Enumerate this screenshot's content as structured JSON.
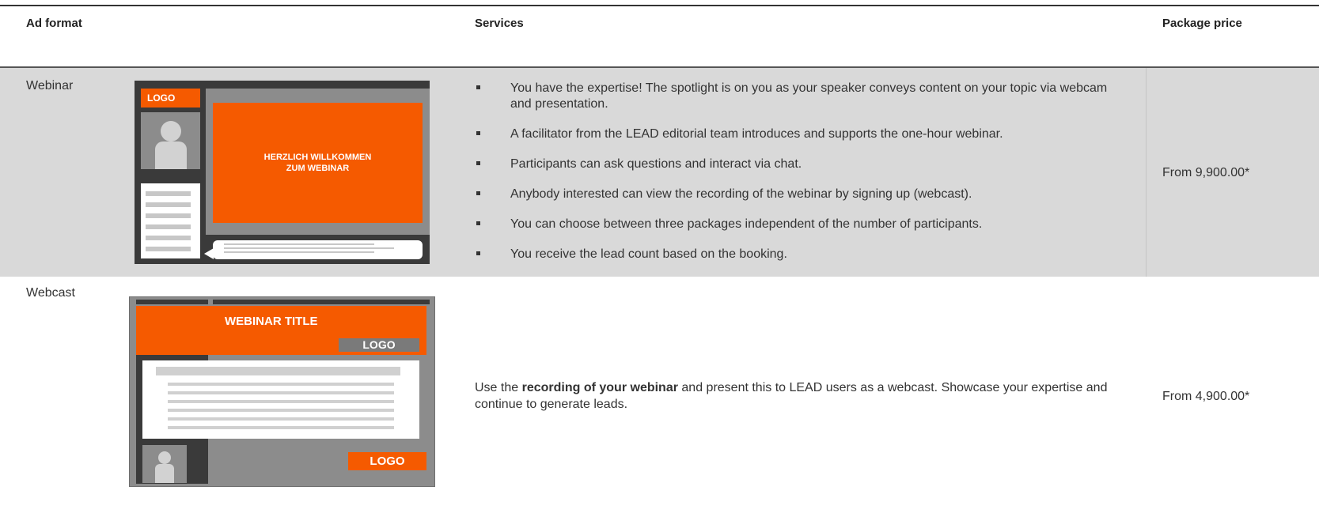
{
  "header": {
    "col_format": "Ad format",
    "col_services": "Services",
    "col_price": "Package price"
  },
  "rows": [
    {
      "format": "Webinar",
      "illustration": {
        "logo": "LOGO",
        "slide_text": "HERZLICH WILLKOMMEN\nZUM WEBINAR"
      },
      "services": [
        "You have the expertise! The spotlight is on you as your speaker conveys content on your topic via webcam and presentation.",
        "A facilitator from the LEAD editorial team introduces and supports the one-hour webinar.",
        "Participants can ask questions and interact via chat.",
        "Anybody interested can view the recording of the webinar by signing up (webcast).",
        "You can choose between three packages independent of the number of participants.",
        "You receive the lead count based on the booking."
      ],
      "price": "From 9,900.00*"
    },
    {
      "format": "Webcast",
      "illustration": {
        "title": "WEBINAR TITLE",
        "logo_top": "LOGO",
        "logo_bottom": "LOGO"
      },
      "description": {
        "before": "Use the ",
        "bold": "recording of your webinar",
        "after": " and present this to LEAD users as a webcast. Showcase your expertise and continue to generate leads."
      },
      "price": "From 4,900.00*"
    }
  ],
  "colors": {
    "accent": "#f55a00",
    "row_shade": "#d9d9d9",
    "dark_panel": "#3a3a3a",
    "grey_panel": "#8c8c8c"
  }
}
